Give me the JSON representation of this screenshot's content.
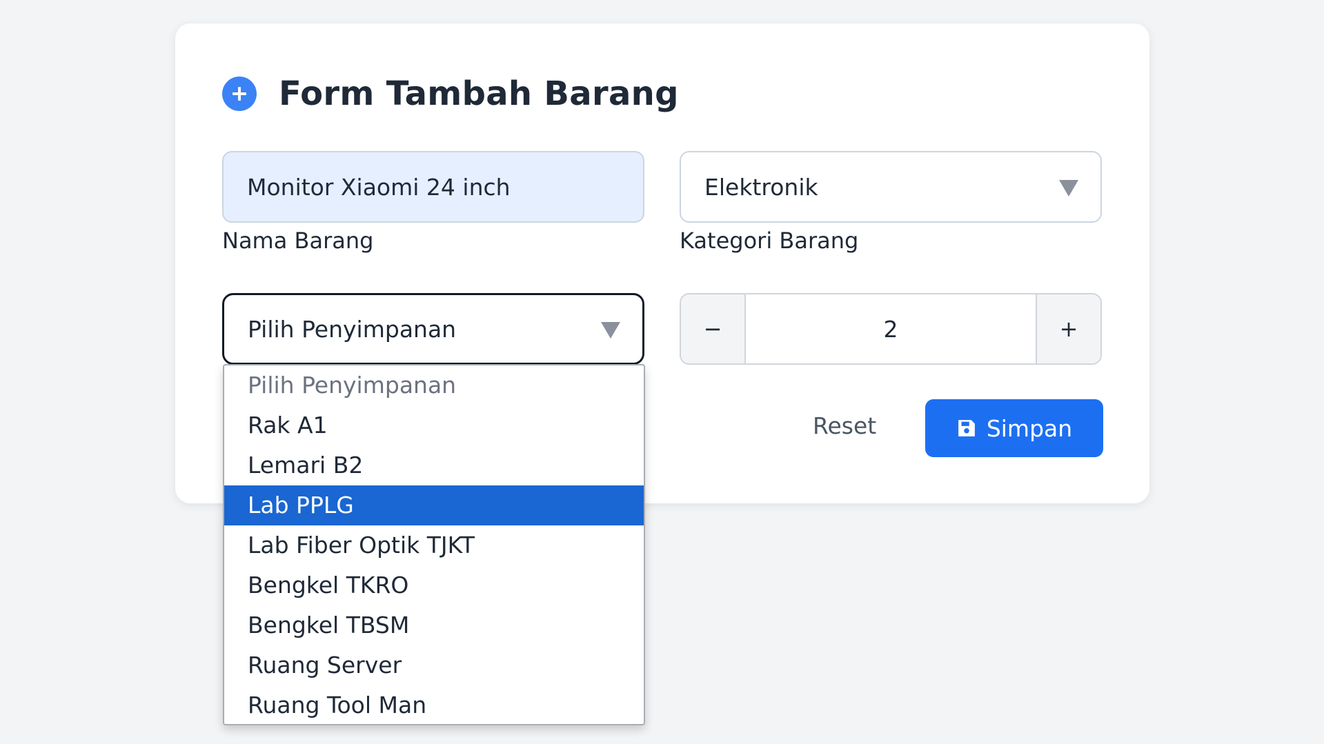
{
  "form": {
    "title": "Form Tambah Barang",
    "name_field": {
      "value": "Monitor Xiaomi 24 inch",
      "label": "Nama Barang"
    },
    "category_field": {
      "value": "Elektronik",
      "label": "Kategori Barang"
    },
    "storage_field": {
      "value": "Pilih Penyimpanan"
    },
    "quantity": {
      "minus": "−",
      "value": "2",
      "plus": "+"
    },
    "reset_label": "Reset",
    "save_label": "Simpan"
  },
  "storage_options": [
    {
      "label": "Pilih Penyimpanan",
      "placeholder": true
    },
    {
      "label": "Rak A1"
    },
    {
      "label": "Lemari B2"
    },
    {
      "label": "Lab PPLG",
      "highlighted": true
    },
    {
      "label": "Lab Fiber Optik TJKT"
    },
    {
      "label": "Bengkel TKRO"
    },
    {
      "label": "Bengkel TBSM"
    },
    {
      "label": "Ruang Server"
    },
    {
      "label": "Ruang Tool Man"
    }
  ],
  "colors": {
    "accent": "#1d6ff2",
    "highlight": "#1a66d2",
    "icon_circle": "#3b82f6",
    "name_field_bg": "#e6efff"
  },
  "icons": {
    "title_icon": "plus-circle-icon",
    "save_icon": "floppy-disk-icon",
    "select_icon": "caret-down-icon"
  }
}
